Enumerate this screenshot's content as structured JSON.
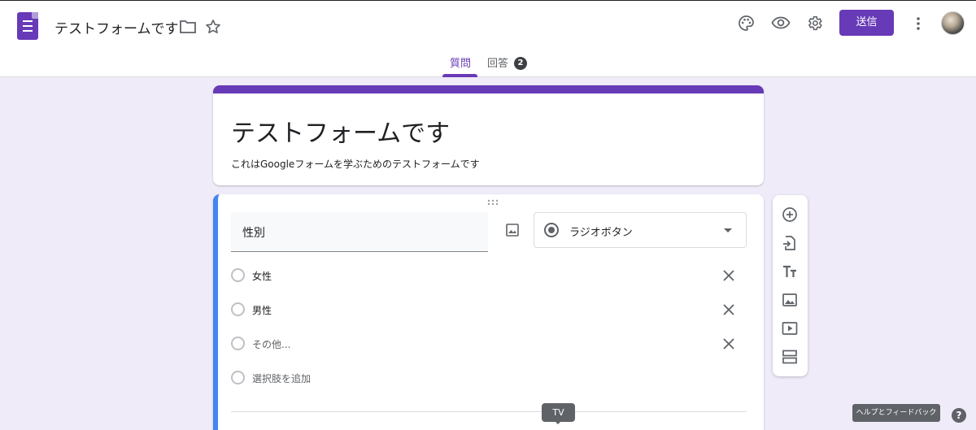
{
  "header": {
    "title": "テストフォームです",
    "send_label": "送信",
    "icons": [
      "forms-app-icon",
      "folder-icon",
      "star-icon",
      "palette-icon",
      "eye-icon",
      "gear-icon",
      "more-vert-icon",
      "avatar"
    ]
  },
  "tabs": [
    {
      "label": "質問",
      "active": true
    },
    {
      "label": "回答",
      "badge": "2"
    }
  ],
  "title_card": {
    "title": "テストフォームです",
    "description": "これはGoogleフォームを学ぶためのテストフォームです"
  },
  "question": {
    "title": "性別",
    "type": "ラジオボタン",
    "options": [
      "女性",
      "男性",
      "その他..."
    ],
    "add_option": "選択肢を追加"
  },
  "side_toolbar": [
    "add-question-icon",
    "import-questions-icon",
    "title-text-icon",
    "image-icon",
    "video-icon",
    "section-icon"
  ],
  "tooltip": "TV",
  "help": {
    "tooltip": "ヘルプとフィードバック",
    "label": "?"
  },
  "colors": {
    "accent": "#673ab7",
    "background": "#f0ebf8",
    "active_card_border": "#4285f4"
  }
}
